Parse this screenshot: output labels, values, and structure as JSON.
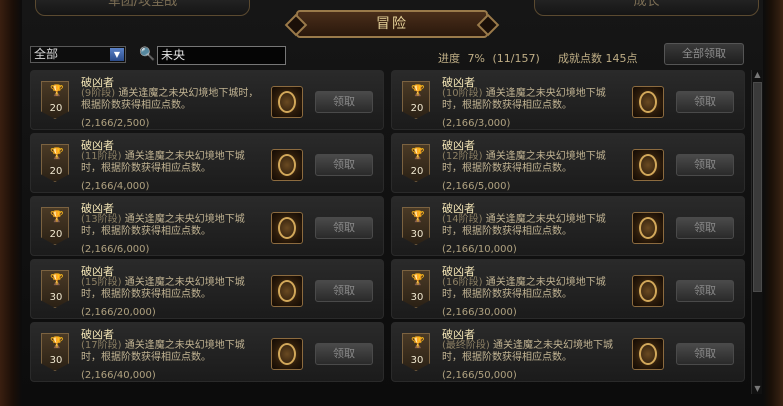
{
  "header": {
    "left_tab": "军团/攻坚战",
    "right_tab": "成长",
    "title": "冒险"
  },
  "filters": {
    "category": "全部",
    "search_value": "未央"
  },
  "stats": {
    "progress_label": "进度",
    "progress_percent": "7%",
    "progress_count": "(11/157)",
    "points_text": "成就点数 145点",
    "claim_all": "全部领取"
  },
  "achievements": [
    {
      "name": "破凶者",
      "stage": "(9阶段)",
      "desc": "通关逢魔之未央幻境地下城时，根据阶数获得相应点数。",
      "count": "(2,166/2,500)",
      "points": "20",
      "claim": "领取"
    },
    {
      "name": "破凶者",
      "stage": "(10阶段)",
      "desc": "通关逢魔之未央幻境地下城时，根据阶数获得相应点数。",
      "count": "(2,166/3,000)",
      "points": "20",
      "claim": "领取"
    },
    {
      "name": "破凶者",
      "stage": "(11阶段)",
      "desc": "通关逢魔之未央幻境地下城时，根据阶数获得相应点数。",
      "count": "(2,166/4,000)",
      "points": "20",
      "claim": "领取"
    },
    {
      "name": "破凶者",
      "stage": "(12阶段)",
      "desc": "通关逢魔之未央幻境地下城时，根据阶数获得相应点数。",
      "count": "(2,166/5,000)",
      "points": "20",
      "claim": "领取"
    },
    {
      "name": "破凶者",
      "stage": "(13阶段)",
      "desc": "通关逢魔之未央幻境地下城时，根据阶数获得相应点数。",
      "count": "(2,166/6,000)",
      "points": "20",
      "claim": "领取"
    },
    {
      "name": "破凶者",
      "stage": "(14阶段)",
      "desc": "通关逢魔之未央幻境地下城时，根据阶数获得相应点数。",
      "count": "(2,166/10,000)",
      "points": "30",
      "claim": "领取"
    },
    {
      "name": "破凶者",
      "stage": "(15阶段)",
      "desc": "通关逢魔之未央幻境地下城时，根据阶数获得相应点数。",
      "count": "(2,166/20,000)",
      "points": "30",
      "claim": "领取"
    },
    {
      "name": "破凶者",
      "stage": "(16阶段)",
      "desc": "通关逢魔之未央幻境地下城时，根据阶数获得相应点数。",
      "count": "(2,166/30,000)",
      "points": "30",
      "claim": "领取"
    },
    {
      "name": "破凶者",
      "stage": "(17阶段)",
      "desc": "通关逢魔之未央幻境地下城时，根据阶数获得相应点数。",
      "count": "(2,166/40,000)",
      "points": "30",
      "claim": "领取"
    },
    {
      "name": "破凶者",
      "stage": "(最终阶段)",
      "desc": "通关逢魔之未央幻境地下城时，根据阶数获得相应点数。",
      "count": "(2,166/50,000)",
      "points": "30",
      "claim": "领取"
    }
  ]
}
